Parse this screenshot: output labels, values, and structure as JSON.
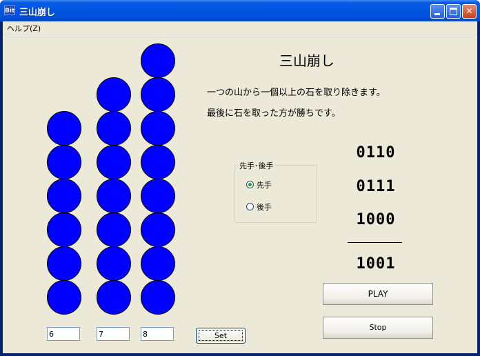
{
  "window": {
    "title": "三山崩し",
    "app_icon": "app-icon",
    "icon_text": "Bit"
  },
  "menu": {
    "help": "ヘルプ(Z)"
  },
  "piles": [
    6,
    7,
    8
  ],
  "inputs": {
    "pile1": "6",
    "pile2": "7",
    "pile3": "8",
    "set_label": "Set"
  },
  "game": {
    "title": "三山崩し",
    "desc1": "一つの山から一個以上の石を取り除きます。",
    "desc2": "最後に石を取った方が勝ちです。"
  },
  "turn_group": {
    "label": "先手･後手",
    "options": [
      "先手",
      "後手"
    ],
    "selected": "先手"
  },
  "binary": {
    "rows": [
      "0110",
      "0111",
      "1000"
    ],
    "xor": "1001"
  },
  "buttons": {
    "play": "PLAY",
    "stop": "Stop"
  },
  "colors": {
    "stone": "#0000ff",
    "background": "#ece9d8"
  }
}
